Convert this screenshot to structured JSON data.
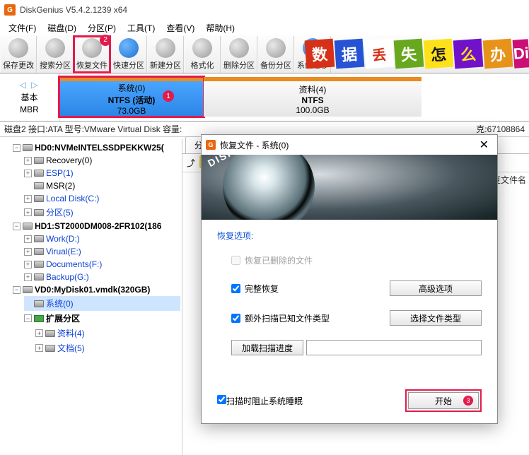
{
  "app": {
    "icon": "G",
    "title": "DiskGenius V5.4.2.1239 x64"
  },
  "menu": [
    "文件(F)",
    "磁盘(D)",
    "分区(P)",
    "工具(T)",
    "查看(V)",
    "帮助(H)"
  ],
  "toolbar": [
    {
      "label": "保存更改",
      "name": "save-changes-button"
    },
    {
      "label": "搜索分区",
      "name": "search-partition-button"
    },
    {
      "label": "恢复文件",
      "name": "recover-files-button",
      "highlight": true,
      "badge": "2"
    },
    {
      "label": "快速分区",
      "name": "quick-partition-button"
    },
    {
      "label": "新建分区",
      "name": "new-partition-button"
    },
    {
      "label": "格式化",
      "name": "format-button"
    },
    {
      "label": "删除分区",
      "name": "delete-partition-button"
    },
    {
      "label": "备份分区",
      "name": "backup-partition-button"
    },
    {
      "label": "系统迁移",
      "name": "system-migration-button"
    }
  ],
  "banner": {
    "chars": [
      "数",
      "据",
      "丢",
      "失",
      "怎",
      "么",
      "办"
    ],
    "right": "Di"
  },
  "partrow": {
    "left": {
      "arrows": "◁ ▷",
      "l1": "基本",
      "l2": "MBR"
    },
    "p1": {
      "l1": "系统(0)",
      "l2": "NTFS (活动)",
      "l3": "73.0GB",
      "badge": "1"
    },
    "p2": {
      "l1": "资料(4)",
      "l2": "NTFS",
      "l3": "100.0GB"
    }
  },
  "status": {
    "left": "磁盘2 接口:ATA 型号:VMware Virtual Disk 容量:",
    "right": "克:67108864"
  },
  "tree": {
    "d0": "HD0:NVMeINTELSSDPEKKW25(",
    "d0c": [
      "Recovery(0)",
      "ESP(1)",
      "MSR(2)",
      "Local Disk(C:)",
      "分区(5)"
    ],
    "d1": "HD1:ST2000DM008-2FR102(186",
    "d1c": [
      "Work(D:)",
      "Virual(E:)",
      "Documents(F:)",
      "Backup(G:)"
    ],
    "d2": "VD0:MyDisk01.vmdk(320GB)",
    "d2a": "系统(0)",
    "d2b": "扩展分区",
    "d2bc": [
      "资料(4)",
      "文档(5)"
    ]
  },
  "list": {
    "tab": "分区",
    "col_right": "豆文件名"
  },
  "dialog": {
    "title": "恢复文件 - 系统(0)",
    "brand": "DISKGENIUS",
    "section": "恢复选项:",
    "opt_deleted": "恢复已删除的文件",
    "opt_full": "完整恢复",
    "btn_adv": "高级选项",
    "opt_extra": "额外扫描已知文件类型",
    "btn_types": "选择文件类型",
    "btn_load": "加载扫描进度",
    "opt_sleep": "扫描时阻止系统睡眠",
    "btn_start": "开始",
    "badge_start": "3"
  }
}
